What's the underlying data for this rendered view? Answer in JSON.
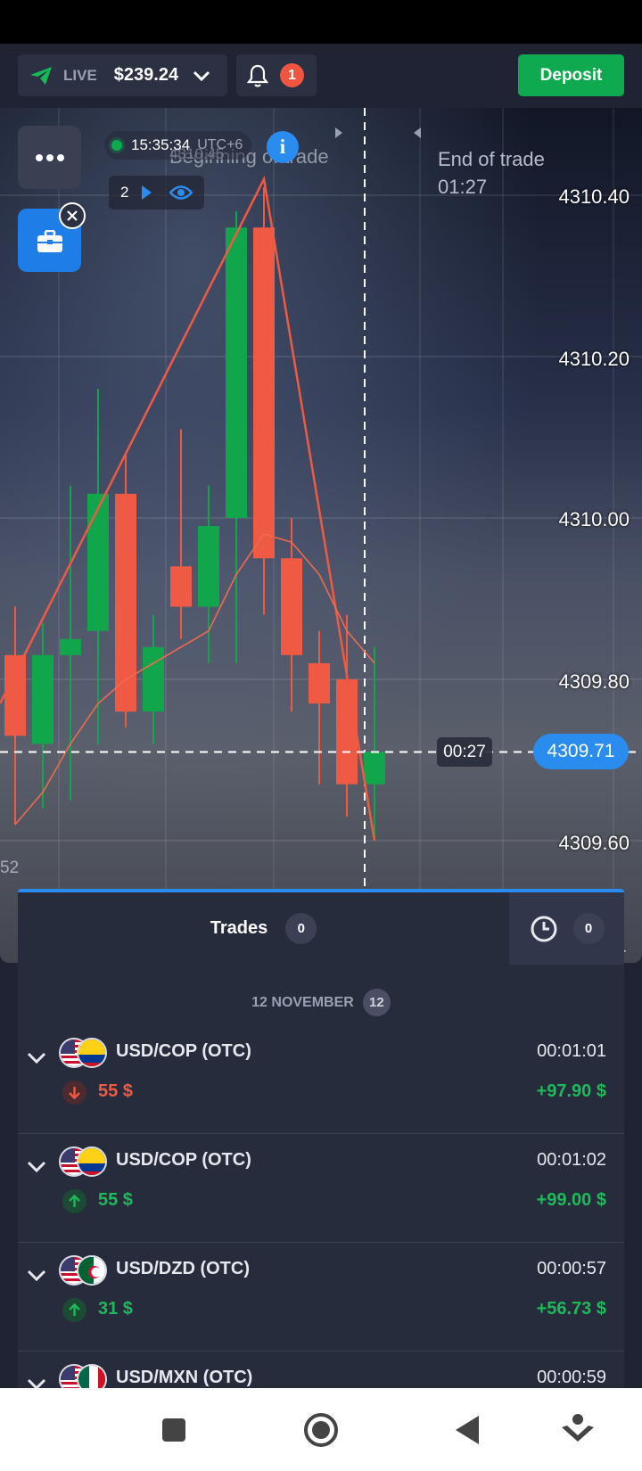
{
  "topbar": {
    "account_type": "LIVE",
    "balance": "$239.24",
    "notifications_count": "1",
    "deposit_label": "Deposit"
  },
  "chart": {
    "clock_time": "15:35:34",
    "timezone": "UTC+6",
    "faded_price": "4310.45",
    "beginning_label": "Beginning of trade",
    "end_label": "End of trade",
    "end_countdown": "01:27",
    "open_trades_count": "2",
    "price_levels": [
      "4310.40",
      "4310.20",
      "4310.00",
      "4309.80",
      "4309.60"
    ],
    "current_price": "4309.71",
    "candle_timer": "00:27",
    "edge_left_text": "52",
    "edge_right_text": "4"
  },
  "chart_data": {
    "type": "candlestick",
    "y_ticks": [
      4310.4,
      4310.2,
      4310.0,
      4309.8,
      4309.6
    ],
    "current_price": 4309.71,
    "colors": {
      "up": "#11a64c",
      "down": "#ef5a45"
    },
    "candles": [
      {
        "o": 4309.83,
        "c": 4309.73,
        "h": 4309.89,
        "l": 4309.62,
        "dir": "down"
      },
      {
        "o": 4309.72,
        "c": 4309.83,
        "h": 4309.87,
        "l": 4309.64,
        "dir": "up"
      },
      {
        "o": 4309.83,
        "c": 4309.85,
        "h": 4310.04,
        "l": 4309.65,
        "dir": "up"
      },
      {
        "o": 4309.86,
        "c": 4310.03,
        "h": 4310.16,
        "l": 4309.72,
        "dir": "up"
      },
      {
        "o": 4310.03,
        "c": 4309.76,
        "h": 4310.08,
        "l": 4309.74,
        "dir": "down"
      },
      {
        "o": 4309.76,
        "c": 4309.84,
        "h": 4309.88,
        "l": 4309.72,
        "dir": "up"
      },
      {
        "o": 4309.94,
        "c": 4309.89,
        "h": 4310.11,
        "l": 4309.85,
        "dir": "down"
      },
      {
        "o": 4309.89,
        "c": 4309.99,
        "h": 4310.04,
        "l": 4309.82,
        "dir": "up"
      },
      {
        "o": 4310.0,
        "c": 4310.36,
        "h": 4310.38,
        "l": 4309.82,
        "dir": "up"
      },
      {
        "o": 4310.36,
        "c": 4309.95,
        "h": 4310.41,
        "l": 4309.88,
        "dir": "down"
      },
      {
        "o": 4309.95,
        "c": 4309.83,
        "h": 4310.0,
        "l": 4309.76,
        "dir": "down"
      },
      {
        "o": 4309.82,
        "c": 4309.77,
        "h": 4309.86,
        "l": 4309.67,
        "dir": "down"
      },
      {
        "o": 4309.8,
        "c": 4309.67,
        "h": 4309.88,
        "l": 4309.63,
        "dir": "down"
      },
      {
        "o": 4309.67,
        "c": 4309.71,
        "h": 4309.84,
        "l": 4309.6,
        "dir": "up"
      }
    ]
  },
  "trades_panel": {
    "tab_trades_label": "Trades",
    "tab_trades_count": "0",
    "tab_history_count": "0",
    "date_label": "12 NOVEMBER",
    "date_count": "12",
    "trades": [
      {
        "pair": "USD/COP (OTC)",
        "duration": "00:01:01",
        "direction": "down",
        "amount": "55 $",
        "profit": "+97.90 $",
        "flag2": "colombia"
      },
      {
        "pair": "USD/COP (OTC)",
        "duration": "00:01:02",
        "direction": "up",
        "amount": "55 $",
        "profit": "+99.00 $",
        "flag2": "colombia"
      },
      {
        "pair": "USD/DZD (OTC)",
        "duration": "00:00:57",
        "direction": "up",
        "amount": "31 $",
        "profit": "+56.73 $",
        "flag2": "algeria"
      },
      {
        "pair": "USD/MXN (OTC)",
        "duration": "00:00:59",
        "direction": "up",
        "amount": "",
        "profit": "",
        "flag2": "mexico"
      }
    ]
  }
}
